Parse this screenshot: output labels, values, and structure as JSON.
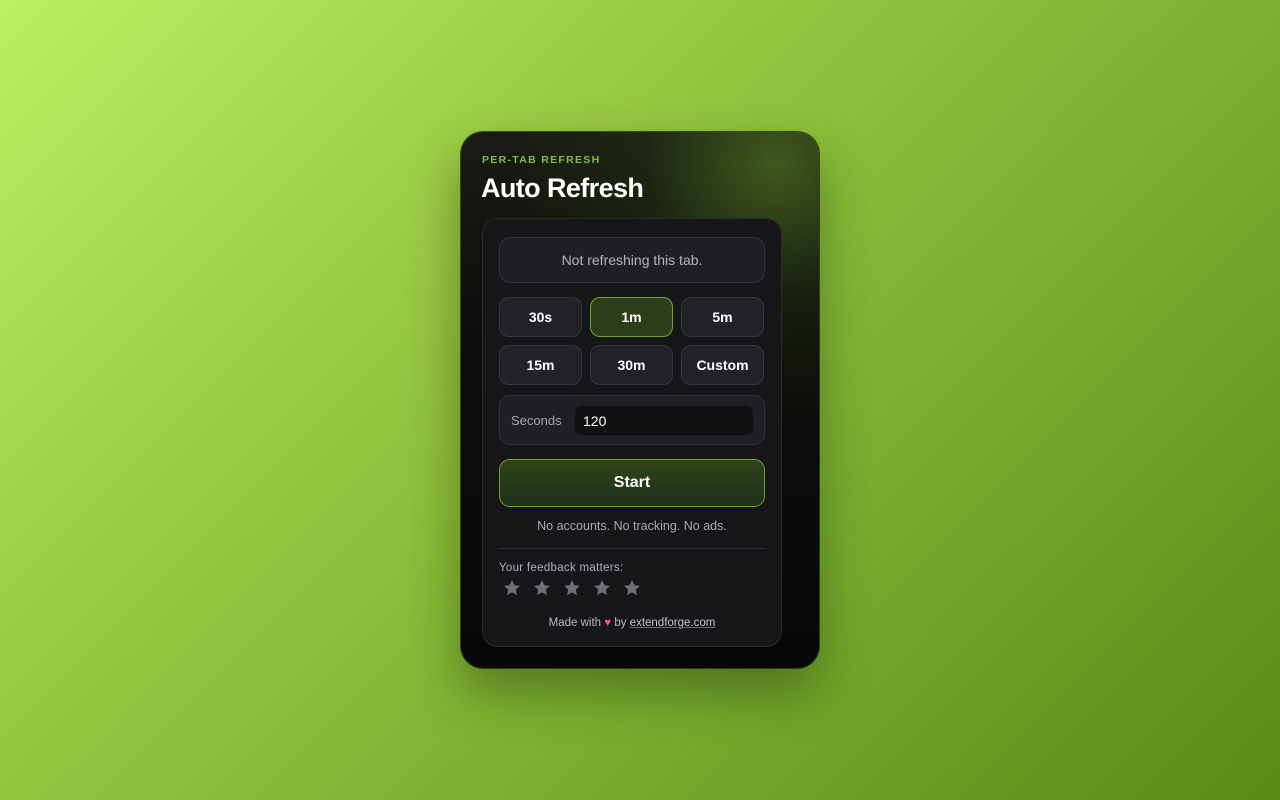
{
  "header": {
    "eyebrow": "PER-TAB REFRESH",
    "title": "Auto Refresh"
  },
  "status": {
    "text": "Not refreshing this tab."
  },
  "intervals": [
    {
      "label": "30s",
      "active": false
    },
    {
      "label": "1m",
      "active": true
    },
    {
      "label": "5m",
      "active": false
    },
    {
      "label": "15m",
      "active": false
    },
    {
      "label": "30m",
      "active": false
    },
    {
      "label": "Custom",
      "active": false
    }
  ],
  "seconds": {
    "label": "Seconds",
    "value": "120"
  },
  "start_label": "Start",
  "privacy_note": "No accounts. No tracking. No ads.",
  "feedback": {
    "label": "Your feedback matters:",
    "rating": 0,
    "max_rating": 5
  },
  "footer": {
    "made_with": "Made with",
    "heart_icon": "heart-icon",
    "by": "by",
    "link_text": "extendforge.com"
  },
  "colors": {
    "accent": "#7fbf3a",
    "active_border": "#6fa52e",
    "star": "#6e6f73"
  }
}
